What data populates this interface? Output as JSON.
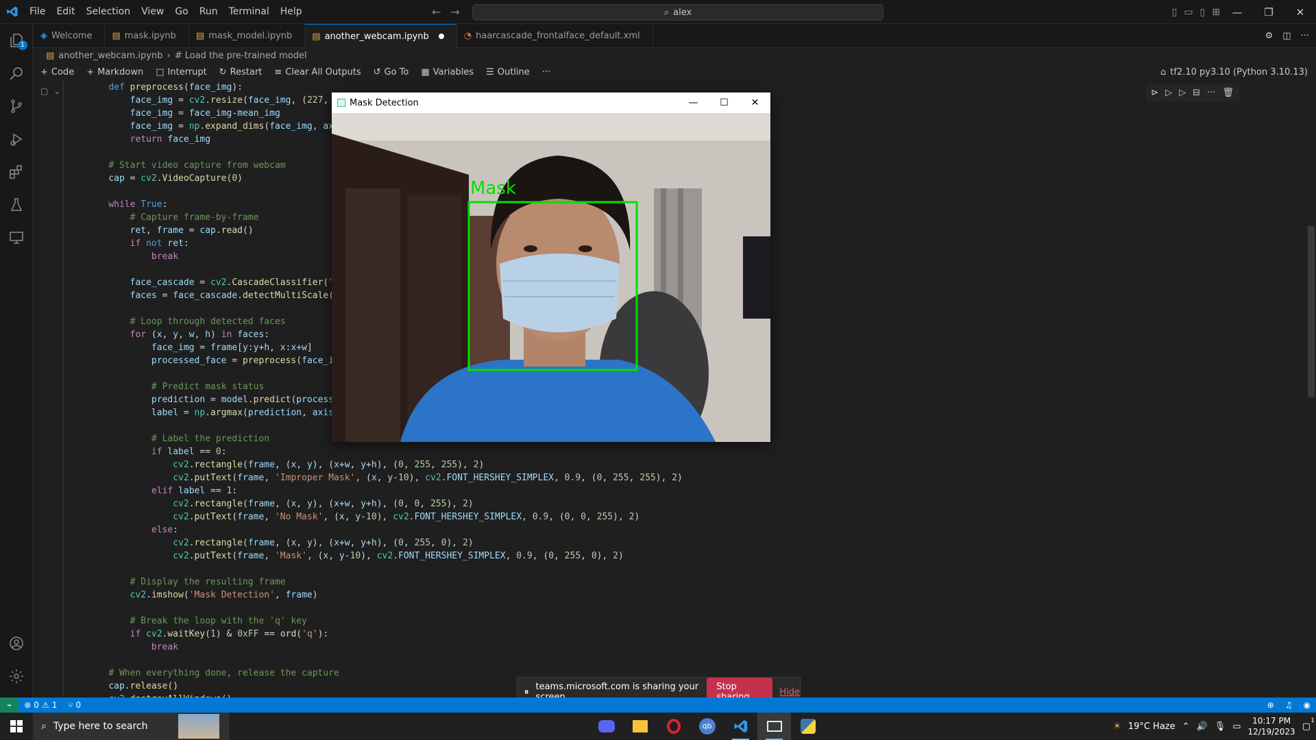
{
  "titlebar": {
    "menu": [
      "File",
      "Edit",
      "Selection",
      "View",
      "Go",
      "Run",
      "Terminal",
      "Help"
    ],
    "search_text": "alex"
  },
  "tabs": [
    {
      "label": "Welcome",
      "icon": "vscode-icon"
    },
    {
      "label": "mask.ipynb",
      "icon": "notebook-icon"
    },
    {
      "label": "mask_model.ipynb",
      "icon": "notebook-icon"
    },
    {
      "label": "another_webcam.ipynb",
      "icon": "notebook-icon",
      "active": true,
      "modified": true
    },
    {
      "label": "haarcascade_frontalface_default.xml",
      "icon": "rss-icon"
    }
  ],
  "breadcrumb": {
    "file": "another_webcam.ipynb",
    "section": "# Load the pre-trained model"
  },
  "toolbar": {
    "code": "Code",
    "markdown": "Markdown",
    "interrupt": "Interrupt",
    "restart": "Restart",
    "clear_outputs": "Clear All Outputs",
    "go_to": "Go To",
    "variables": "Variables",
    "outline": "Outline",
    "more": "···",
    "kernel": "tf2.10 py3.10 (Python 3.10.13)"
  },
  "mask_window": {
    "title": "Mask Detection",
    "overlay_label": "Mask",
    "box_color": "#00e000"
  },
  "share_bar": {
    "message": "teams.microsoft.com is sharing your screen.",
    "stop": "Stop sharing",
    "hide": "Hide"
  },
  "statusbar": {
    "errors": "0",
    "warnings": "1",
    "ports": "0"
  },
  "taskbar": {
    "search_placeholder": "Type here to search",
    "weather": "19°C  Haze",
    "time": "10:17 PM",
    "date": "12/19/2023",
    "notification_count": "1"
  },
  "colors": {
    "accent": "#0078d4",
    "editor_bg": "#1f1f1f",
    "stop_red": "#c4314b"
  }
}
